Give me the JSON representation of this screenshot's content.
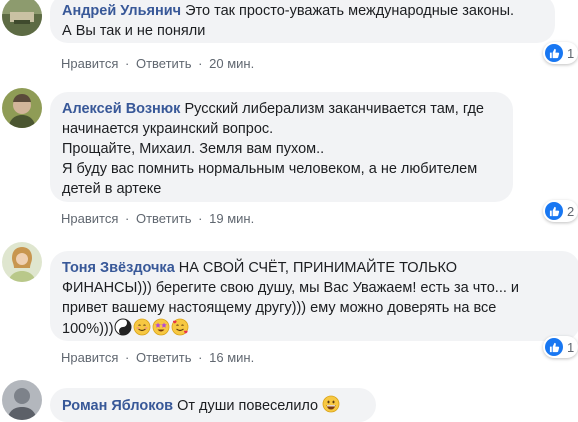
{
  "comments": [
    {
      "author": "Андрей Ульянич",
      "lines": [
        "Это так просто-уважать международные законы.",
        "А Вы так и не поняли"
      ],
      "actions": {
        "like": "Нравится",
        "reply": "Ответить",
        "time": "20 мин."
      },
      "reactions": "1",
      "avatar_color": "#6b7a5a"
    },
    {
      "author": "Алексей Вознюк",
      "lines": [
        "Русский либерализм заканчивается там, где",
        "начинается украинский вопрос.",
        "Прощайте, Михаил. Земля вам пухом..",
        "Я буду вас помнить нормальным человеком, а не любителем",
        "детей в артеке"
      ],
      "actions": {
        "like": "Нравится",
        "reply": "Ответить",
        "time": "19 мин."
      },
      "reactions": "2",
      "avatar_color": "#7b8c4a"
    },
    {
      "author": "Тоня Звёздочка",
      "lines": [
        "НА СВОЙ СЧЁТ, ПРИНИМАЙТЕ ТОЛЬКО",
        "ФИНАНСЫ))) берегите свою душу, мы Вас Уважаем! есть за что... и",
        "привет вашему настоящему другу))) ему можно доверять на все",
        "100%)))"
      ],
      "actions": {
        "like": "Нравится",
        "reply": "Ответить",
        "time": "16 мин."
      },
      "reactions": "1",
      "avatar_color": "#c9a779"
    },
    {
      "author": "Роман Яблоков",
      "lines": [
        "От души повеселило"
      ],
      "avatar_color": "#8a8f96"
    }
  ],
  "separator": "·",
  "colors": {
    "author": "#385898",
    "bubble": "#f2f3f5",
    "meta": "#606770",
    "like": "#1877f2"
  },
  "icons": {
    "like": "thumbs-up-icon",
    "emoji_yinyang": "yin-yang-icon",
    "emoji_smile": "smiling-face-icon",
    "emoji_star": "star-struck-icon",
    "emoji_hearts": "smiling-face-with-hearts-icon",
    "emoji_grin": "grinning-face-icon"
  }
}
